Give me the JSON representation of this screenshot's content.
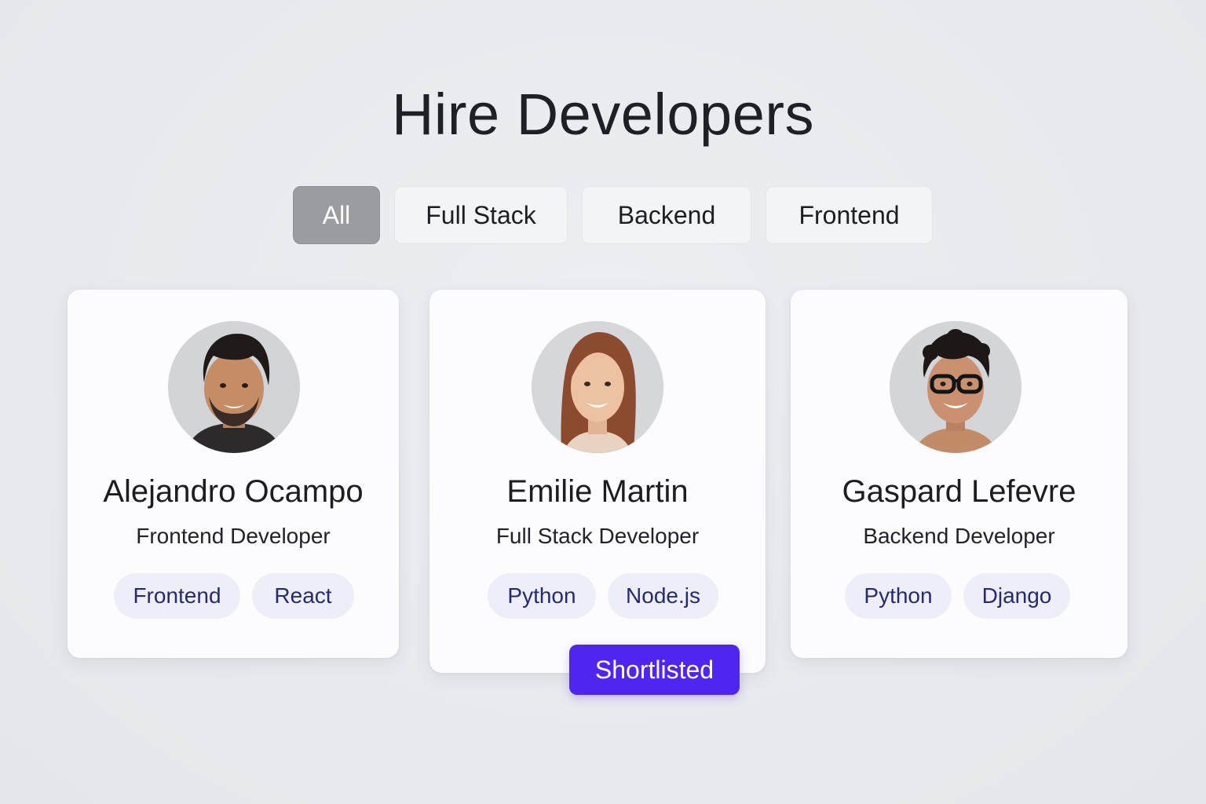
{
  "page": {
    "title": "Hire Developers"
  },
  "filters": [
    {
      "label": "All",
      "active": true
    },
    {
      "label": "Full Stack",
      "active": false
    },
    {
      "label": "Backend",
      "active": false
    },
    {
      "label": "Frontend",
      "active": false
    }
  ],
  "developers": [
    {
      "name": "Alejandro Ocampo",
      "role": "Frontend Developer",
      "tags": [
        "Frontend",
        "React"
      ],
      "avatar_icon": "avatar-man-beard-icon",
      "shortlisted": false
    },
    {
      "name": "Emilie Martin",
      "role": "Full Stack Developer",
      "tags": [
        "Python",
        "Node.js"
      ],
      "avatar_icon": "avatar-woman-icon",
      "shortlisted": true,
      "badge_label": "Shortlisted"
    },
    {
      "name": "Gaspard Lefevre",
      "role": "Backend Developer",
      "tags": [
        "Python",
        "Django"
      ],
      "avatar_icon": "avatar-man-glasses-icon",
      "shortlisted": false
    }
  ],
  "colors": {
    "accent": "#4f26ef",
    "tag_bg": "#eeeef9",
    "tag_text": "#262a6e",
    "active_filter": "#9a9ca1",
    "card_bg": "#fcfcfe"
  }
}
